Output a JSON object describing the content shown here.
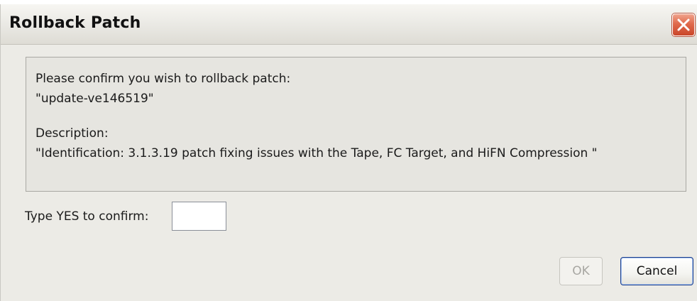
{
  "window": {
    "title": "Rollback Patch",
    "close_icon": "close-icon"
  },
  "info": {
    "confirm_message": "Please confirm you wish to rollback patch:",
    "patch_name": "\"update-ve146519\"",
    "description_label": "Description:",
    "description_text": "\"Identification: 3.1.3.19 patch fixing issues with the Tape, FC Target, and HiFN Compression \""
  },
  "confirm": {
    "label": "Type YES to confirm:",
    "value": "",
    "placeholder": ""
  },
  "buttons": {
    "ok_label": "OK",
    "ok_enabled": false,
    "cancel_label": "Cancel"
  },
  "colors": {
    "dialog_bg": "#ecebe6",
    "close_button": "#d9553a",
    "cancel_focus_border": "#1c3f8c",
    "disabled_text": "#a8a7a2"
  }
}
